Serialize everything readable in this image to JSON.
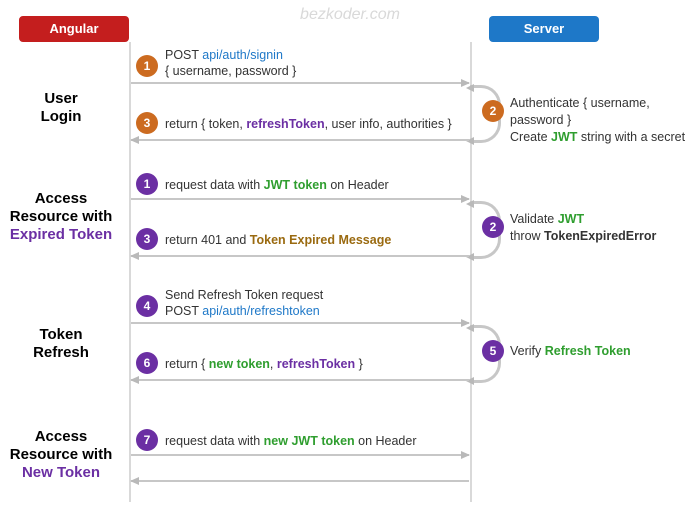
{
  "watermark": "bezkoder.com",
  "lanes": {
    "angular": "Angular",
    "server": "Server"
  },
  "sections": {
    "userLogin": {
      "l1": "User",
      "l2": "Login"
    },
    "accessExpired": {
      "l1": "Access",
      "l2": "Resource with",
      "l3": "Expired Token"
    },
    "tokenRefresh": {
      "l1": "Token",
      "l2": "Refresh"
    },
    "accessNew": {
      "l1": "Access",
      "l2": "Resource with",
      "l3": "New Token"
    }
  },
  "steps": {
    "s1_login_pre": "POST ",
    "s1_login_url": "api/auth/signin",
    "s1_login_body": "{ username, password }",
    "s2_auth_l1": "Authenticate { username, password }",
    "s2_auth_l2a": "Create ",
    "s2_auth_l2b": "JWT",
    "s2_auth_l2c": " string with a secret",
    "s3_return_a": "return { token, ",
    "s3_return_b": "refreshToken",
    "s3_return_c": ", user info, authorities }",
    "a1_a": "request data with ",
    "a1_b": "JWT token",
    "a1_c": " on Header",
    "a2_a": "Validate ",
    "a2_b": "JWT",
    "a2_c": "throw ",
    "a2_d": "TokenExpiredError",
    "a3_a": "return 401 and ",
    "a3_b": "Token Expired Message",
    "r4_l1": "Send Refresh Token request",
    "r4_l2a": "POST ",
    "r4_l2b": "api/auth/refreshtoken",
    "r5_a": "Verify ",
    "r5_b": "Refresh Token",
    "r6_a": "return { ",
    "r6_b": "new token",
    "r6_c": ", ",
    "r6_d": "refreshToken",
    "r6_e": " }",
    "n7_a": "request data with ",
    "n7_b": "new JWT token",
    "n7_c": " on Header"
  },
  "badges": {
    "s1": "1",
    "s2": "2",
    "s3": "3",
    "a1": "1",
    "a2": "2",
    "a3": "3",
    "r4": "4",
    "r5": "5",
    "r6": "6",
    "n7": "7"
  }
}
